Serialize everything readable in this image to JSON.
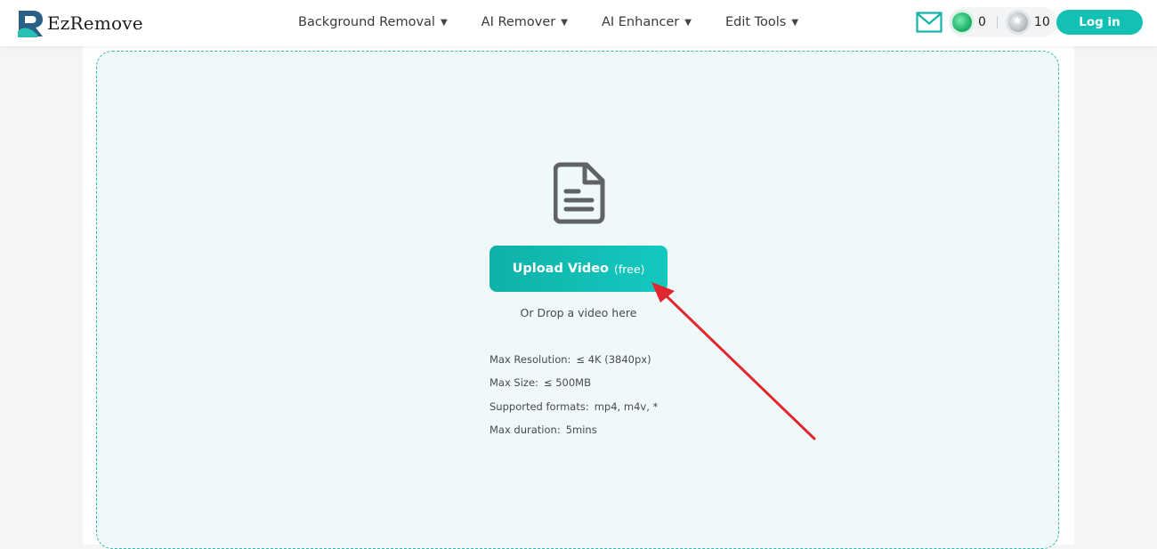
{
  "brand": {
    "name": "EzRemove"
  },
  "nav": [
    {
      "label": "Background Removal"
    },
    {
      "label": "AI Remover"
    },
    {
      "label": "AI Enhancer"
    },
    {
      "label": "Edit Tools"
    }
  ],
  "header": {
    "green_credits": "0",
    "star_credits": "10",
    "login_label": "Log in"
  },
  "upload": {
    "button_label": "Upload Video",
    "button_tag": "(free)",
    "drop_hint": "Or Drop a video here"
  },
  "specs": [
    {
      "label": "Max Resolution:",
      "value": "≤ 4K (3840px)"
    },
    {
      "label": "Max Size:",
      "value": "≤ 500MB"
    },
    {
      "label": "Supported formats:",
      "value": "mp4, m4v, *"
    },
    {
      "label": "Max duration:",
      "value": "5mins"
    }
  ],
  "colors": {
    "accent": "#12c0b4",
    "dropzone_border": "#3bb7a9",
    "dropzone_bg": "#eff9fa",
    "annotation_arrow": "#e0262e"
  },
  "icons": [
    "logo-mark-icon",
    "caret-down-icon",
    "mail-icon",
    "green-coin-icon",
    "star-coin-icon",
    "document-icon",
    "annotation-arrow"
  ]
}
